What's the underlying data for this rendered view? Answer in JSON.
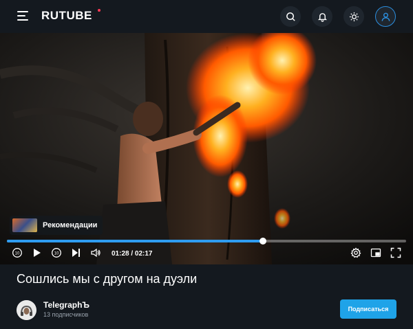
{
  "header": {
    "logo": "RUTUBE",
    "menu_icon": "hamburger-menu-icon",
    "search_icon": "search-icon",
    "notifications_icon": "bell-icon",
    "theme_icon": "sun-icon",
    "profile_icon": "user-icon"
  },
  "player": {
    "recommendations_label": "Рекомендации",
    "current_time": "01:28",
    "duration": "02:17",
    "time_display": "01:28 / 02:17",
    "progress_fraction": 0.642,
    "controls": [
      "rewind-10-icon",
      "play-icon",
      "forward-10-icon",
      "next-icon",
      "volume-icon",
      "settings-icon",
      "picture-in-picture-icon",
      "fullscreen-icon"
    ]
  },
  "video": {
    "title": "Сошлись мы с другом на дуэли"
  },
  "channel": {
    "name": "TelegraphЪ",
    "subscribers": "13 подписчиков",
    "subscribe_label": "Подписаться"
  },
  "colors": {
    "background": "#14191f",
    "accent": "#2f9cf0",
    "subscribe_button": "#1fa3e8",
    "logo_dot": "#ff3b56"
  }
}
